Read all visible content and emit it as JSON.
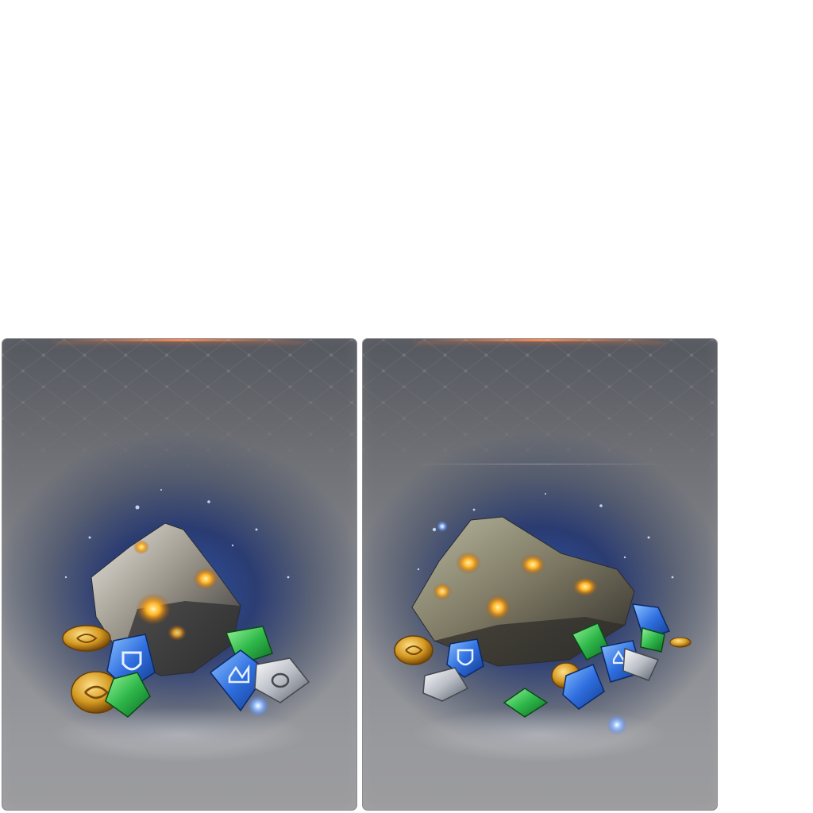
{
  "cards": [
    {
      "id": "card-1",
      "item": "small-ore-rune-bundle",
      "ore_icon": "glowing-ore-rock-icon",
      "runes": [
        "blue-shield-rune-icon",
        "green-rune-icon",
        "blue-crown-rune-icon",
        "silver-rune-icon"
      ],
      "coins": [
        "gold-coin-icon",
        "gold-coin-icon"
      ]
    },
    {
      "id": "card-2",
      "item": "large-ore-rune-bundle",
      "ore_icon": "glowing-ore-rock-icon",
      "runes": [
        "blue-shield-rune-icon",
        "green-rune-icon",
        "blue-crown-rune-icon",
        "silver-rune-icon",
        "green-rune-icon"
      ],
      "coins": [
        "gold-coin-icon",
        "gold-coin-icon",
        "gold-coin-icon"
      ]
    }
  ],
  "colors": {
    "accent_glow": "#ff8c50",
    "ore_glow": "#ffb020",
    "rune_blue": "#2f6fe0",
    "rune_green": "#2fb84a",
    "coin_gold": "#d49a22"
  }
}
